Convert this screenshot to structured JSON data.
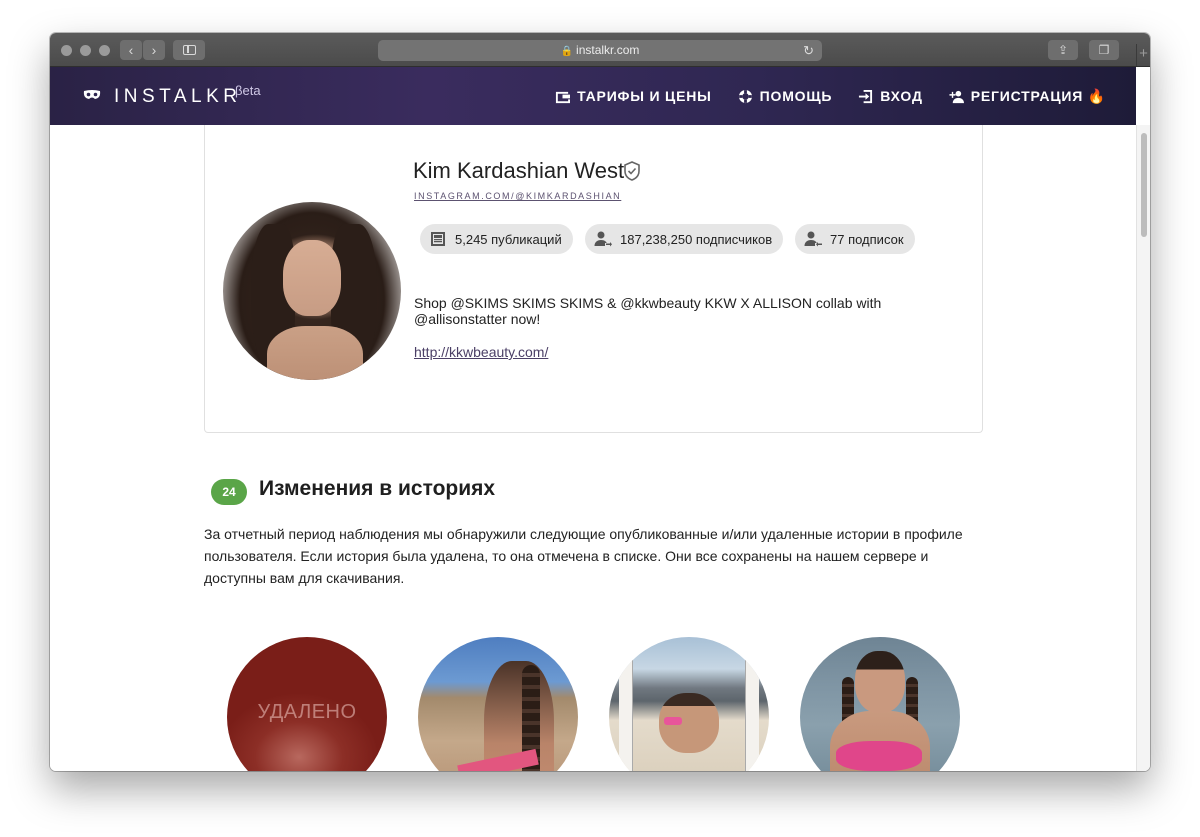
{
  "browser": {
    "url": "instalkr.com"
  },
  "site": {
    "logo": "INSTALKR",
    "beta": "βeta",
    "menu": [
      {
        "label": "ТАРИФЫ И ЦЕНЫ",
        "icon": "wallet-icon"
      },
      {
        "label": "ПОМОЩЬ",
        "icon": "lifebuoy-icon"
      },
      {
        "label": "ВХОД",
        "icon": "login-icon"
      },
      {
        "label": "РЕГИСТРАЦИЯ 🔥",
        "icon": "add-user-icon"
      }
    ],
    "colors": {
      "header_bg": "#2e2650",
      "badge_green": "#5aa548",
      "link": "#4b3f66"
    }
  },
  "profile": {
    "name": "Kim Kardashian West",
    "link": "INSTAGRAM.COM/@KIMKARDASHIAN",
    "stats": {
      "posts": "5,245 публикаций",
      "followers": "187,238,250 подписчиков",
      "following": "77 подписок"
    },
    "bio": "Shop @SKIMS SKIMS SKIMS & @kkwbeauty KKW X ALLISON collab with @allisonstatter now!",
    "url": "http://kkwbeauty.com/"
  },
  "stories_section": {
    "count": "24",
    "title": "Изменения в историях",
    "text": "За отчетный период наблюдения мы обнаружили следующие опубликованные и/или удаленные истории в профиле пользователя. Если история была удалена, то она отмечена в списке. Они все сохранены на нашем сервере и доступны вам для скачивания.",
    "deleted_label": "УДАЛЕНО"
  }
}
